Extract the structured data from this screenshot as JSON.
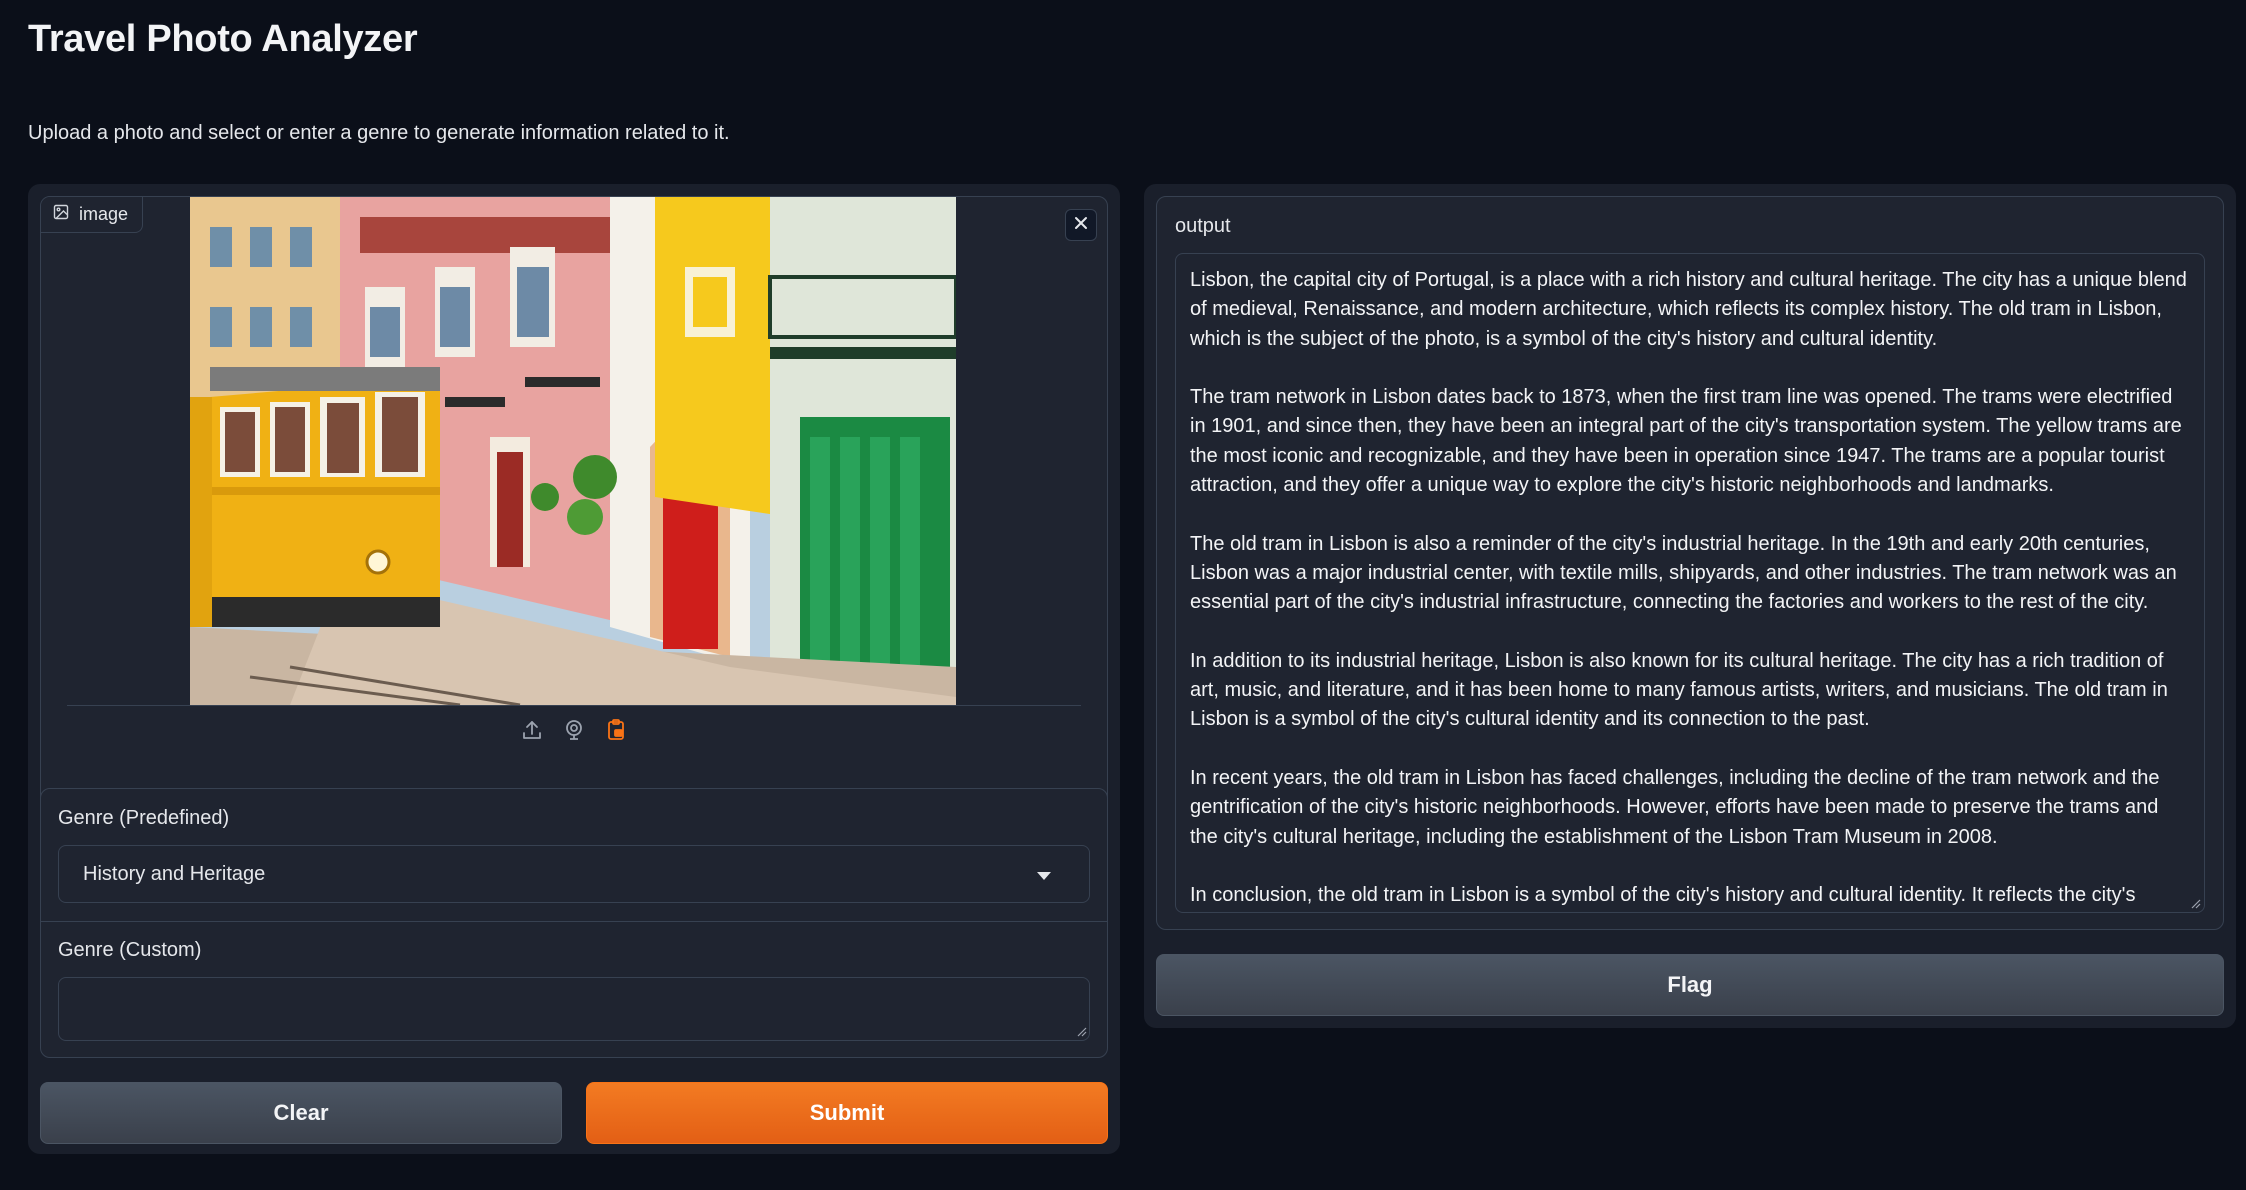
{
  "app": {
    "title": "Travel Photo Analyzer",
    "description": "Upload a photo and select or enter a genre to generate information related to it."
  },
  "image_input": {
    "label": "image",
    "label_icon": "image-icon",
    "close_icon": "close-icon",
    "source_icons": [
      "upload-icon",
      "webcam-icon",
      "clipboard-icon"
    ],
    "active_source_color": "#f97316"
  },
  "genre_predefined": {
    "label": "Genre (Predefined)",
    "selected": "History and Heritage"
  },
  "genre_custom": {
    "label": "Genre (Custom)",
    "value": ""
  },
  "buttons": {
    "clear": "Clear",
    "submit": "Submit",
    "flag": "Flag"
  },
  "output": {
    "label": "output",
    "text": "Lisbon, the capital city of Portugal, is a place with a rich history and cultural heritage. The city has a unique blend of medieval, Renaissance, and modern architecture, which reflects its complex history. The old tram in Lisbon, which is the subject of the photo, is a symbol of the city's history and cultural identity.\n\nThe tram network in Lisbon dates back to 1873, when the first tram line was opened. The trams were electrified in 1901, and since then, they have been an integral part of the city's transportation system. The yellow trams are the most iconic and recognizable, and they have been in operation since 1947. The trams are a popular tourist attraction, and they offer a unique way to explore the city's historic neighborhoods and landmarks.\n\nThe old tram in Lisbon is also a reminder of the city's industrial heritage. In the 19th and early 20th centuries, Lisbon was a major industrial center, with textile mills, shipyards, and other industries. The tram network was an essential part of the city's industrial infrastructure, connecting the factories and workers to the rest of the city.\n\nIn addition to its industrial heritage, Lisbon is also known for its cultural heritage. The city has a rich tradition of art, music, and literature, and it has been home to many famous artists, writers, and musicians. The old tram in Lisbon is a symbol of the city's cultural identity and its connection to the past.\n\nIn recent years, the old tram in Lisbon has faced challenges, including the decline of the tram network and the gentrification of the city's historic neighborhoods. However, efforts have been made to preserve the trams and the city's cultural heritage, including the establishment of the Lisbon Tram Museum in 2008.\n\nIn conclusion, the old tram in Lisbon is a symbol of the city's history and cultural identity. It reflects the city's"
  },
  "colors": {
    "background": "#0b0f19",
    "panel": "#1f2430",
    "border": "#374151",
    "accent": "#f97316"
  }
}
